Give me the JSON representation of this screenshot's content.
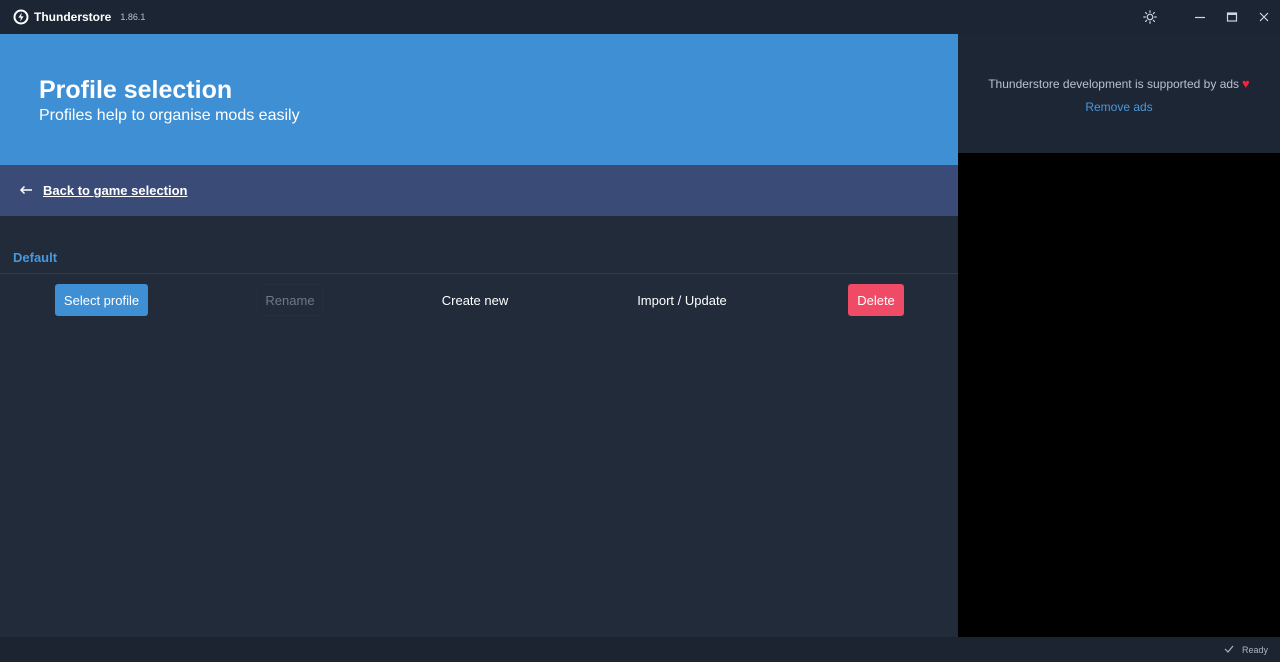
{
  "titlebar": {
    "app_name": "Thunderstore",
    "version": "1.86.1",
    "logo_icon": "thunderstore-logo-icon",
    "controls": [
      "theme-icon",
      "minimize-icon",
      "maximize-icon",
      "close-icon"
    ]
  },
  "hero": {
    "title": "Profile selection",
    "subtitle": "Profiles help to organise mods easily",
    "background": "#3f8fd4"
  },
  "back": {
    "label": "Back to game selection",
    "icon": "arrow-left-icon"
  },
  "profile": {
    "name": "Default"
  },
  "actions": {
    "select": "Select profile",
    "rename": "Rename",
    "create": "Create new",
    "import": "Import / Update",
    "delete": "Delete"
  },
  "ads": {
    "message": "Thunderstore development is supported by ads",
    "heart": "♥",
    "remove": "Remove ads"
  },
  "status": {
    "text": "Ready",
    "icon": "check-icon"
  },
  "colors": {
    "accent": "#3f8fd4",
    "danger": "#ef4b67",
    "panel": "#212b3a"
  }
}
